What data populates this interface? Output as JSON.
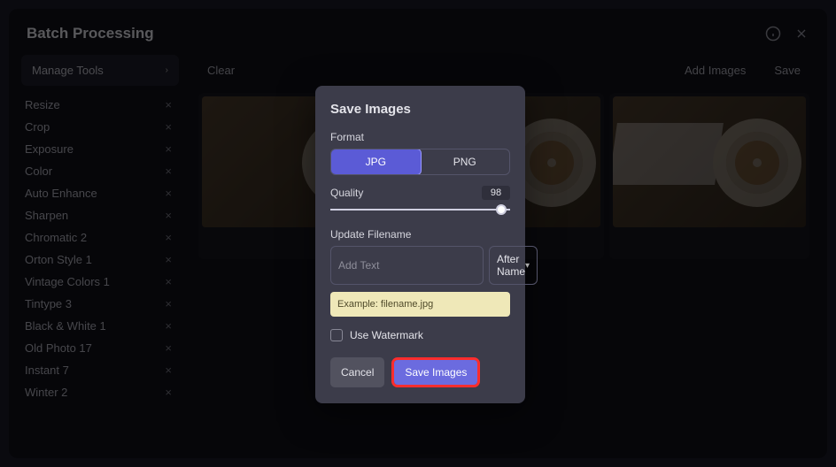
{
  "header": {
    "title": "Batch Processing"
  },
  "sidebar": {
    "manage_label": "Manage Tools",
    "tools": [
      "Resize",
      "Crop",
      "Exposure",
      "Color",
      "Auto Enhance",
      "Sharpen",
      "Chromatic 2",
      "Orton Style 1",
      "Vintage Colors 1",
      "Tintype 3",
      "Black & White 1",
      "Old Photo 17",
      "Instant 7",
      "Winter 2"
    ]
  },
  "toolbar": {
    "clear": "Clear",
    "add_images": "Add Images",
    "save": "Save"
  },
  "modal": {
    "title": "Save Images",
    "format_label": "Format",
    "format_options": {
      "jpg": "JPG",
      "png": "PNG"
    },
    "quality_label": "Quality",
    "quality_value": "98",
    "update_filename_label": "Update Filename",
    "add_text_placeholder": "Add Text",
    "position_value": "After Name",
    "example_prefix": "Example: ",
    "example_value": "filename.jpg",
    "watermark_label": "Use Watermark",
    "cancel": "Cancel",
    "save_images": "Save Images"
  }
}
